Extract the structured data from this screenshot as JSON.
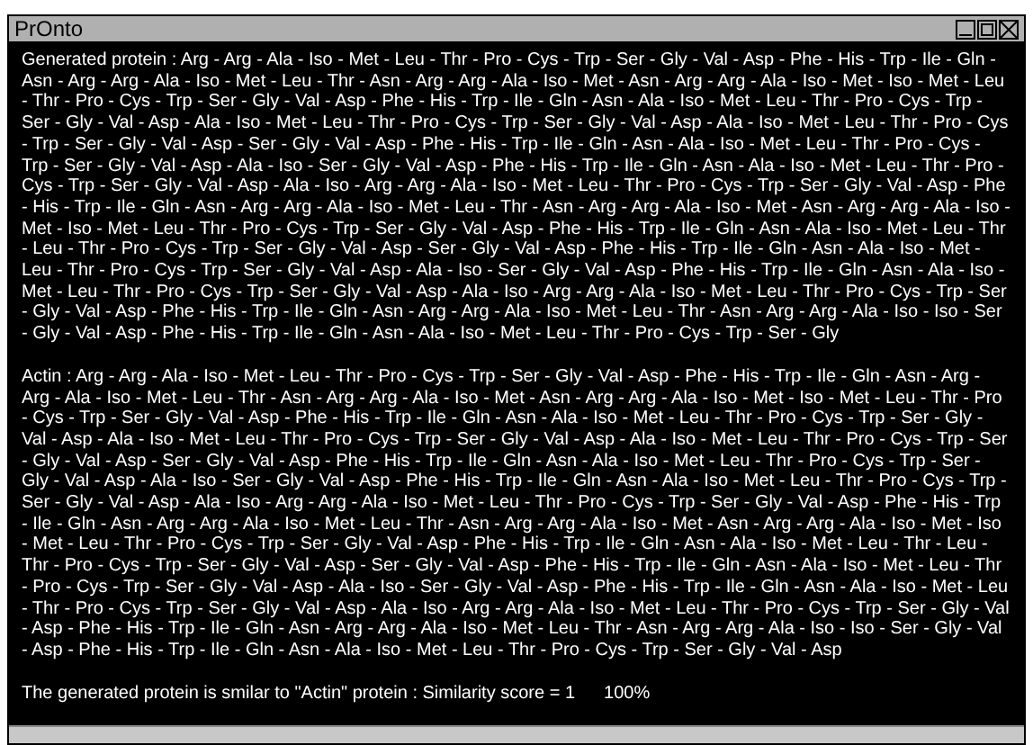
{
  "window": {
    "title": "PrOnto"
  },
  "generated_protein": "Generated protein : Arg - Arg - Ala - Iso - Met - Leu - Thr - Pro - Cys - Trp - Ser - Gly - Val - Asp - Phe - His - Trp - Ile - Gln - Asn - Arg - Arg - Ala - Iso - Met - Leu - Thr - Asn - Arg - Arg - Ala - Iso - Met - Asn - Arg - Arg - Ala - Iso - Met - Iso - Met - Leu - Thr - Pro - Cys - Trp - Ser - Gly - Val - Asp - Phe - His - Trp - Ile - Gln - Asn - Ala - Iso - Met - Leu - Thr - Pro - Cys - Trp - Ser - Gly - Val - Asp - Ala - Iso - Met - Leu - Thr - Pro - Cys - Trp - Ser - Gly - Val - Asp - Ala - Iso - Met - Leu - Thr - Pro - Cys - Trp - Ser - Gly - Val - Asp - Ser - Gly - Val - Asp - Phe - His - Trp - Ile - Gln - Asn - Ala - Iso - Met - Leu - Thr - Pro - Cys - Trp - Ser - Gly - Val - Asp - Ala - Iso - Ser - Gly - Val - Asp - Phe - His - Trp - Ile - Gln - Asn - Ala - Iso - Met - Leu - Thr - Pro - Cys - Trp - Ser - Gly - Val - Asp - Ala - Iso - Arg - Arg - Ala - Iso - Met - Leu - Thr - Pro - Cys - Trp - Ser - Gly - Val - Asp - Phe - His - Trp - Ile - Gln - Asn - Arg - Arg - Ala - Iso - Met - Leu - Thr - Asn - Arg - Arg - Ala - Iso - Met - Asn - Arg - Arg - Ala - Iso - Met - Iso - Met - Leu - Thr - Pro - Cys - Trp - Ser - Gly - Val - Asp - Phe - His - Trp - Ile - Gln - Asn - Ala - Iso - Met - Leu - Thr - Leu - Thr - Pro - Cys - Trp - Ser - Gly - Val - Asp - Ser - Gly - Val - Asp - Phe - His - Trp - Ile - Gln - Asn - Ala - Iso - Met - Leu - Thr - Pro - Cys - Trp - Ser - Gly - Val - Asp - Ala - Iso - Ser - Gly - Val - Asp - Phe - His - Trp - Ile - Gln - Asn - Ala - Iso - Met - Leu - Thr - Pro - Cys - Trp - Ser - Gly - Val - Asp - Ala - Iso - Arg - Arg - Ala - Iso - Met - Leu - Thr - Pro - Cys - Trp - Ser - Gly - Val - Asp - Phe - His - Trp - Ile - Gln - Asn - Arg - Arg - Ala - Iso - Met - Leu - Thr - Asn - Arg - Arg - Ala - Iso - Iso - Ser - Gly - Val - Asp - Phe - His - Trp - Ile - Gln - Asn - Ala - Iso - Met - Leu - Thr - Pro - Cys - Trp - Ser - Gly",
  "actin": "Actin : Arg - Arg - Ala - Iso - Met - Leu - Thr - Pro - Cys - Trp - Ser - Gly - Val - Asp - Phe - His - Trp - Ile - Gln - Asn - Arg - Arg - Ala - Iso - Met - Leu - Thr - Asn - Arg - Arg - Ala - Iso - Met - Asn - Arg - Arg - Ala - Iso - Met - Iso - Met - Leu - Thr - Pro - Cys - Trp - Ser - Gly - Val - Asp - Phe - His - Trp - Ile - Gln - Asn - Ala - Iso - Met - Leu - Thr - Pro - Cys - Trp - Ser - Gly - Val - Asp - Ala - Iso - Met - Leu - Thr - Pro - Cys - Trp - Ser - Gly - Val - Asp - Ala - Iso - Met - Leu - Thr - Pro - Cys - Trp - Ser - Gly - Val - Asp - Ser - Gly - Val - Asp - Phe - His - Trp - Ile - Gln - Asn - Ala - Iso - Met - Leu - Thr - Pro - Cys - Trp - Ser - Gly - Val - Asp - Ala - Iso - Ser - Gly - Val - Asp - Phe - His - Trp - Ile - Gln - Asn - Ala - Iso - Met - Leu - Thr - Pro - Cys - Trp - Ser - Gly - Val - Asp - Ala - Iso - Arg - Arg - Ala - Iso - Met - Leu - Thr - Pro - Cys - Trp - Ser - Gly - Val - Asp - Phe - His - Trp - Ile - Gln - Asn - Arg - Arg - Ala - Iso - Met - Leu - Thr - Asn - Arg - Arg - Ala - Iso - Met - Asn - Arg - Arg - Ala - Iso - Met - Iso - Met - Leu - Thr - Pro - Cys - Trp - Ser - Gly - Val - Asp - Phe - His - Trp - Ile - Gln - Asn - Ala - Iso - Met - Leu - Thr - Leu - Thr - Pro - Cys - Trp - Ser - Gly - Val - Asp - Ser - Gly - Val - Asp - Phe - His - Trp - Ile - Gln - Asn - Ala - Iso - Met - Leu - Thr - Pro - Cys - Trp - Ser - Gly - Val - Asp - Ala - Iso - Ser - Gly - Val - Asp - Phe - His - Trp - Ile - Gln - Asn - Ala - Iso - Met - Leu - Thr - Pro - Cys - Trp - Ser - Gly - Val - Asp - Ala - Iso - Arg - Arg - Ala - Iso - Met - Leu - Thr - Pro - Cys - Trp - Ser - Gly - Val - Asp - Phe - His - Trp - Ile - Gln - Asn - Arg - Arg - Ala - Iso - Met - Leu - Thr - Asn - Arg - Arg - Ala - Iso - Iso - Ser - Gly - Val - Asp - Phe - His - Trp - Ile - Gln - Asn - Ala - Iso - Met - Leu - Thr - Pro - Cys - Trp - Ser - Gly - Val - Asp",
  "result": {
    "message": "The generated protein is smilar to \"Actin\" protein : Similarity score = 1",
    "percentage": "100%"
  }
}
